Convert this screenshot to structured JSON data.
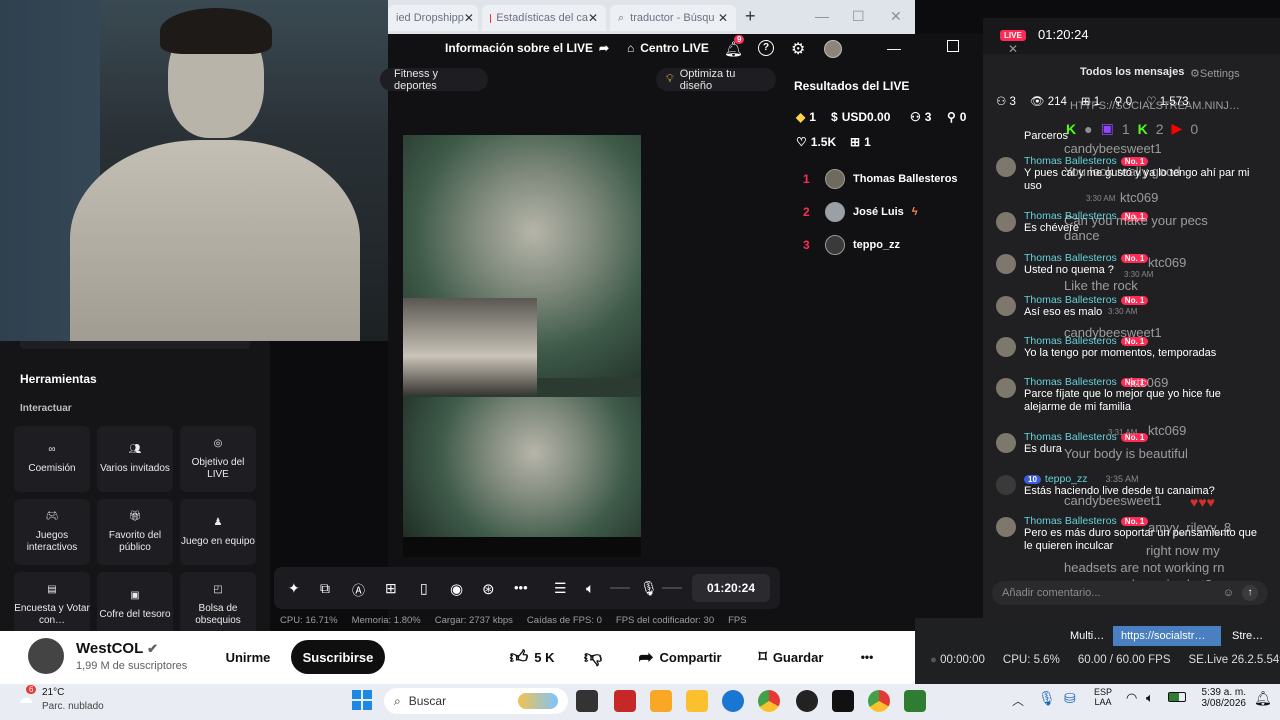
{
  "browser": {
    "tabs": [
      {
        "label": "ied Dropshipp",
        "close": "✕"
      },
      {
        "label": "Estadísticas del ca",
        "close": "✕"
      },
      {
        "label": "traductor - Búsqu",
        "close": "✕"
      }
    ],
    "new_tab": "+"
  },
  "studio": {
    "header": {
      "live_info": "Información sobre el LIVE",
      "live_center": "Centro LIVE",
      "notifications_count": "9"
    },
    "category_pill": "Fitness y deportes",
    "optimize_pill": "Optimiza tu diseño",
    "tools": {
      "title": "Herramientas",
      "section": "Interactuar",
      "items": [
        {
          "label": "Coemisión",
          "icon": "link-icon"
        },
        {
          "label": "Varios invitados",
          "icon": "guests-icon"
        },
        {
          "label": "Objetivo del LIVE",
          "icon": "target-icon"
        },
        {
          "label": "Juegos interactivos",
          "icon": "gamepad-icon"
        },
        {
          "label": "Favorito del público",
          "icon": "gift-icon"
        },
        {
          "label": "Juego en equipo",
          "icon": "team-icon"
        },
        {
          "label": "Encuesta y Votar con…",
          "icon": "poll-icon"
        },
        {
          "label": "Cofre del tesoro",
          "icon": "chest-icon"
        },
        {
          "label": "Bolsa de obsequios",
          "icon": "bag-icon"
        }
      ]
    },
    "timer": "01:20:24",
    "stats": {
      "cpu": "CPU: 16.71%",
      "memory": "Memoria: 1.80%",
      "upload": "Cargar: 2737 kbps",
      "fps_drops": "Caídas de FPS: 0",
      "encoder_fps": "FPS del codificador: 30",
      "cut": "FPS"
    },
    "results": {
      "title": "Resultados del LIVE",
      "diamonds": "1",
      "usd": "USD0.00",
      "viewers": "3",
      "followers": "0",
      "likes": "1.5K",
      "gifts": "1",
      "ranking": [
        {
          "rank": "1",
          "name": "Thomas Ballesteros"
        },
        {
          "rank": "2",
          "name": "José Luis"
        },
        {
          "rank": "3",
          "name": "teppo_zz"
        }
      ]
    }
  },
  "chat": {
    "live_badge": "LIVE",
    "time": "01:20:24",
    "filter": "Todos los mensajes",
    "settings": "Settings",
    "counters": {
      "viewers": "3",
      "views": "214",
      "gifts": "1",
      "follows": "0",
      "likes": "1.573"
    },
    "overlay_url": "HTTPS://SOCIALSTREAM.NINJ…",
    "overlay_counts": [
      "1",
      "2",
      "0"
    ],
    "messages": [
      {
        "name": "",
        "badge": "",
        "text": "Parceros"
      },
      {
        "name": "Thomas Ballesteros",
        "badge": "No. 1",
        "text": "Y pues cal y me gustó y ya lo tengo ahí par mi uso"
      },
      {
        "name": "Thomas Ballesteros",
        "badge": "No. 1",
        "text": "Es chévere"
      },
      {
        "name": "Thomas Ballesteros",
        "badge": "No. 1",
        "text": "Usted no quema ?"
      },
      {
        "name": "Thomas Ballesteros",
        "badge": "No. 1",
        "text": "Así eso es malo"
      },
      {
        "name": "Thomas Ballesteros",
        "badge": "No. 1",
        "text": "Yo la tengo por momentos, temporadas"
      },
      {
        "name": "Thomas Ballesteros",
        "badge": "No. 1",
        "text": "Parce fíjate que lo mejor que yo hice fue alejarme de mi familia"
      },
      {
        "name": "Thomas Ballesteros",
        "badge": "No. 1",
        "text": "Es dura"
      },
      {
        "name": "teppo_zz",
        "badge": "10",
        "time": "3:35 AM",
        "text": "Estás haciendo live desde tu canaima?"
      },
      {
        "name": "Thomas Ballesteros",
        "badge": "No. 1",
        "text": "Pero es más duro soportar un pensamiento que le quieren inculcar"
      }
    ],
    "ghost_lines": [
      "candybeesweet1",
      "You look really good",
      "ktc069",
      "Can you make your pecs dance",
      "ktc069",
      "Like the rock",
      "candybeesweet1",
      "ktc069",
      "ktc069",
      "Your body is beautiful",
      "candybeesweet1",
      "amyy_rilevv_8",
      "right now my",
      "headsets are not working rn",
      "can you reply me in chat?"
    ],
    "ghost_times": [
      "3:30 AM",
      "3:30 AM",
      "3:30 AM",
      "3:31 AM"
    ],
    "input_placeholder": "Añadir comentario..."
  },
  "youtube": {
    "channel": "WestCOL",
    "subscribers": "1,99 M de suscriptores",
    "join": "Unirme",
    "subscribe": "Suscribirse",
    "likes": "5 K",
    "share": "Compartir",
    "save": "Guardar",
    "more": "•••"
  },
  "obs": {
    "tabs": [
      "Multi…",
      "https://socialstr…",
      "Stre…"
    ],
    "rec_time": "00:00:00",
    "cpu": "CPU: 5.6%",
    "fps": "60.00 / 60.00 FPS",
    "version": "SE.Live 26.2.5.549"
  },
  "taskbar": {
    "weather_temp": "21°C",
    "weather_desc": "Parc. nublado",
    "weather_badge": "6",
    "search": "Buscar",
    "lang": "ESP",
    "lang2": "LAA",
    "time": "5:39 a. m.",
    "date": "3/08/2026"
  },
  "colors": {
    "accent": "#fe2c55",
    "chat_name": "#64d2d8",
    "obs_tab_active": "#4a7fc1"
  }
}
